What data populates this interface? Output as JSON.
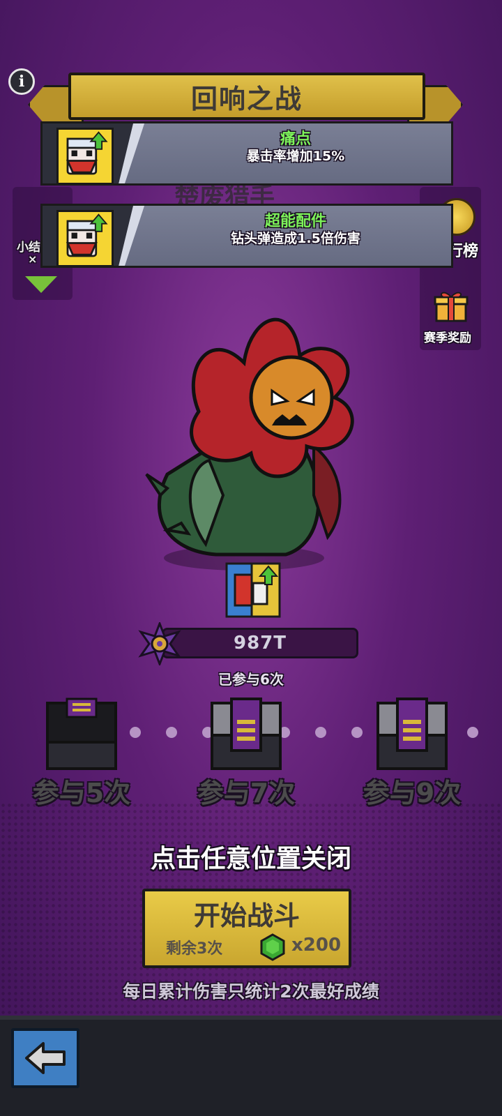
{
  "header": {
    "info_icon": "info-icon",
    "title": "回响之战"
  },
  "buffs": [
    {
      "name": "痛点",
      "desc": "暴击率增加15%",
      "icon": "character-upgrade-icon"
    },
    {
      "name": "超能配件",
      "desc": "钻头弹造成1.5倍伤害",
      "icon": "character-upgrade-icon"
    }
  ],
  "left_panel": {
    "label": "小结",
    "sub": "×",
    "arrow": "chevron-down-icon"
  },
  "hidden_title": "楚废猎手",
  "right_panel": {
    "rank_label": "行榜",
    "rank_icon": "ranking-coin-icon",
    "reward_label": "赛季奖励",
    "reward_icon": "gift-icon"
  },
  "boss": {
    "name": "flower-monster",
    "skill_icon": "skill-upgrade-icon"
  },
  "damage": {
    "value": "987T",
    "participated": "已参与6次"
  },
  "milestones": [
    {
      "label": "参与5次",
      "state": "opened"
    },
    {
      "label": "参与7次",
      "state": "locked"
    },
    {
      "label": "参与9次",
      "state": "locked"
    }
  ],
  "close_hint": "点击任意位置关闭",
  "start": {
    "label": "开始战斗",
    "remaining": "剩余3次",
    "cost": "x200",
    "cost_icon": "gem-icon"
  },
  "footnote": "每日累计伤害只统计2次最好成绩",
  "nav": {
    "back_icon": "back-arrow-icon"
  },
  "colors": {
    "banner": "#d9b83f",
    "buff_name": "#7df25a",
    "background": "#5e1f74",
    "back_button": "#3f7fc3"
  }
}
